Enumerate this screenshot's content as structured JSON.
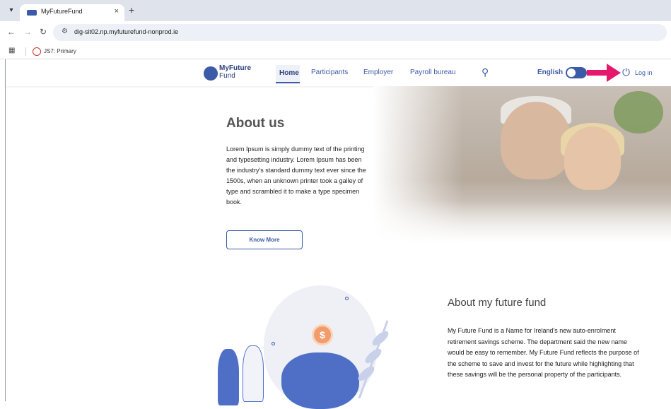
{
  "browser": {
    "tab_title": "MyFutureFund",
    "url": "dig-sit02.np.myfuturefund-nonprod.ie",
    "bookmark_label": "JS7: Primary"
  },
  "site_nav": {
    "logo_line1": "MyFuture",
    "logo_line2": "Fund",
    "items": [
      "Home",
      "Participants",
      "Employer",
      "Payroll bureau"
    ],
    "language": "English",
    "login": "Log in"
  },
  "about": {
    "title": "About us",
    "body": "Lorem Ipsum is simply dummy text of the printing and typesetting industry. Lorem Ipsum has been the industry's standard dummy text ever since the 1500s, when an unknown printer took a galley of type and scrambled it to make a type specimen book.",
    "button": "Know More"
  },
  "fund": {
    "title": "About my future fund",
    "body": "My Future Fund is a Name for Ireland's new auto-enrolment retirement savings scheme. The department said the new name would be easy to remember. My Future Fund reflects the purpose of the scheme to save and invest for the future while highlighting that these savings will be the personal property of the participants."
  },
  "illustration": {
    "coin_symbol": "$"
  },
  "colors": {
    "brand": "#3b5aa7",
    "arrow": "#e6186e"
  }
}
